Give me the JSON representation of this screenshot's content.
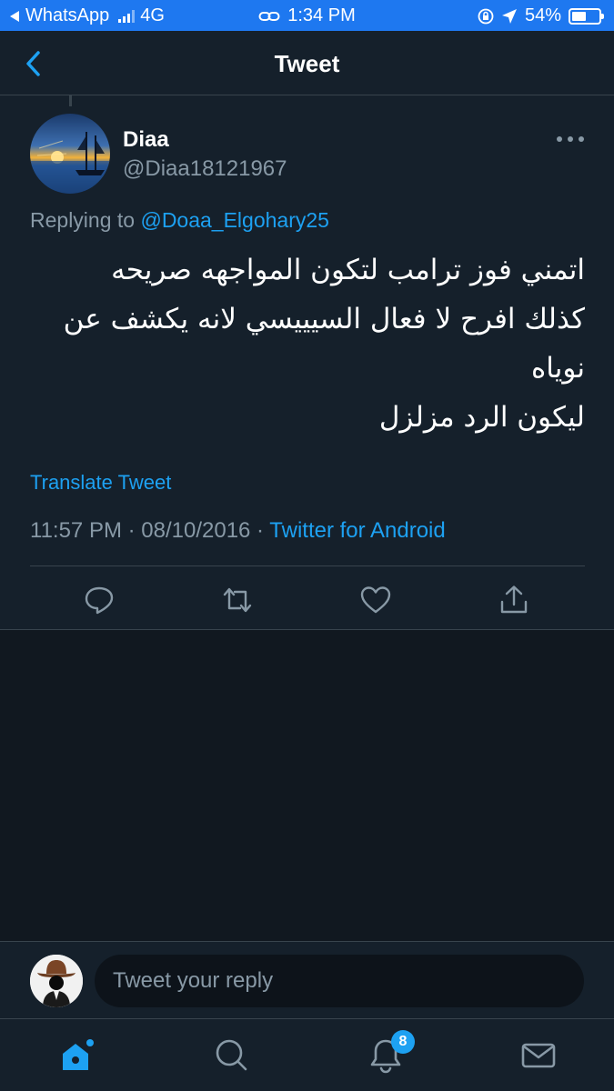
{
  "status_bar": {
    "back_app": "WhatsApp",
    "network": "4G",
    "time": "1:34 PM",
    "battery": "54%",
    "battery_level": 0.54
  },
  "header": {
    "title": "Tweet"
  },
  "tweet": {
    "display_name": "Diaa",
    "handle": "@Diaa18121967",
    "replying_prefix": "Replying to",
    "replying_to": "@Doaa_Elgohary25",
    "text": "اتمني فوز ترامب لتكون المواجهه صريحه\nكذلك  افرح لا فعال السيييسي لانه يكشف عن نوياه\nليكون الرد مزلزل",
    "translate_label": "Translate Tweet",
    "timestamp": "11:57 PM · 08/10/2016 · ",
    "source": "Twitter for Android"
  },
  "actions": {
    "reply": "reply-icon",
    "retweet": "retweet-icon",
    "like": "heart-icon",
    "share": "share-icon"
  },
  "compose": {
    "placeholder": "Tweet your reply"
  },
  "tab_bar": {
    "home": "home-icon",
    "search": "search-icon",
    "notifications": "bell-icon",
    "notifications_badge": "8",
    "messages": "mail-icon"
  },
  "colors": {
    "background": "#15202b",
    "accent": "#1da1f2",
    "secondary_text": "#8899a6",
    "status_bar": "#1e78f0"
  }
}
